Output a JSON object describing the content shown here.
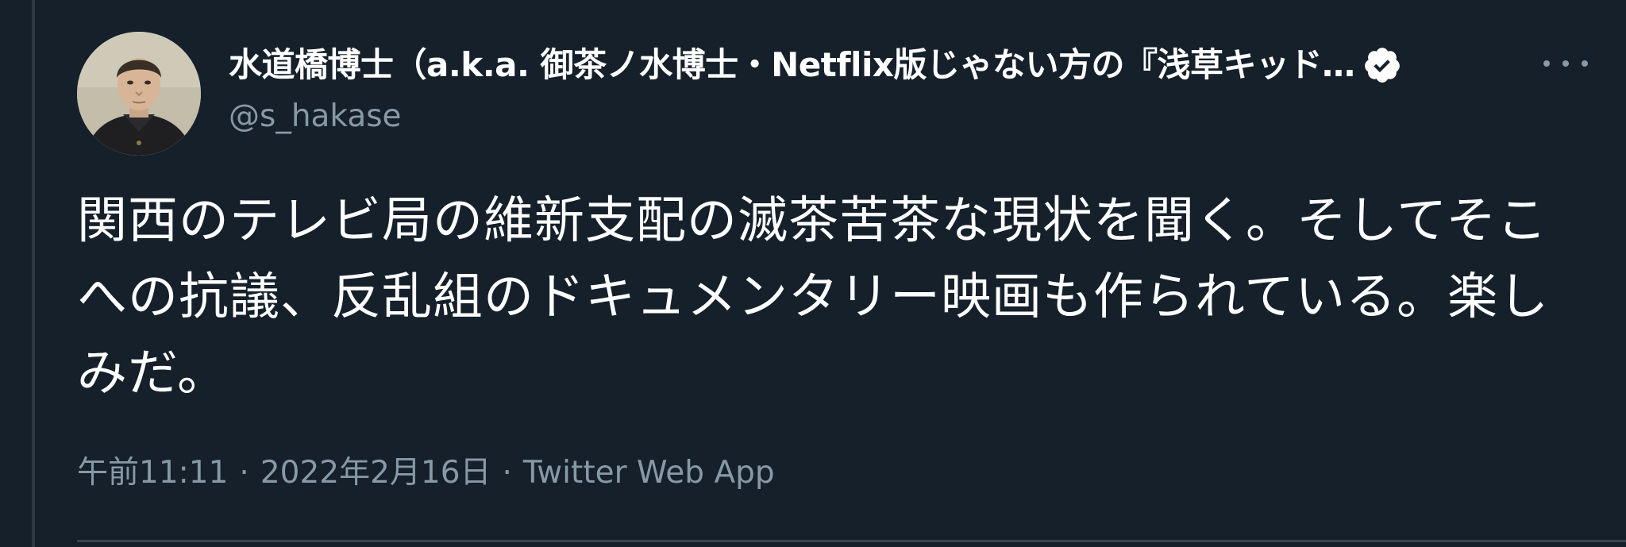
{
  "tweet": {
    "author": {
      "display_name": "水道橋博士（a.k.a. 御茶ノ水博士・Netflix版じゃない方の『浅草キッド…",
      "handle": "@s_hakase",
      "verified_icon": "verified-badge-icon",
      "avatar_icon": "avatar-photo"
    },
    "more_icon": "more-options-icon",
    "text": "関西のテレビ局の維新支配の滅茶苦茶な現状を聞く。そしてそこへの抗議、反乱組のドキュメンタリー映画も作られている。楽しみだ。",
    "meta": {
      "time": "午前11:11",
      "separator_1": "·",
      "date": "2022年2月16日",
      "separator_2": "·",
      "source": "Twitter Web App"
    }
  },
  "colors": {
    "background": "#15202b",
    "primary_text": "#ffffff",
    "secondary_text": "#8899a6",
    "divider": "#38444d"
  }
}
